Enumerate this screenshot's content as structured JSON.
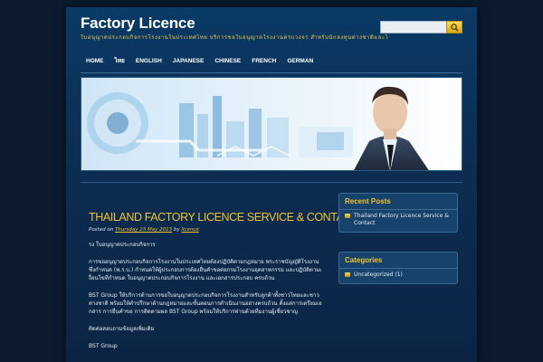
{
  "site": {
    "title": "Factory Licence",
    "tagline": "ใบอนุญาตประกอบกิจการโรงงานในประเทศไทย บริการขอใบอนุญาตโรงงานครบวงจร สำหรับนักลงทุนต่างชาติและไทย"
  },
  "search": {
    "placeholder": ""
  },
  "nav": {
    "items": [
      "HOME",
      "ไทย",
      "ENGLISH",
      "JAPANESE",
      "CHINESE",
      "FRENCH",
      "GERMAN"
    ]
  },
  "post": {
    "title": "THAILAND FACTORY LICENCE SERVICE & CONTACT",
    "meta_prefix": "Posted on",
    "date": "Thursday 23 May 2013",
    "meta_by": "by",
    "author": "licence",
    "paragraphs": [
      "รง ใบอนุญาตประกอบกิจการ",
      "การขออนุญาตประกอบกิจการโรงงานในประเทศไทยต้องปฏิบัติตามกฎหมาย พระราชบัญญัติโรงงานซึ่งกำหนด (พ.ร.บ.) กำหนดให้ผู้ประกอบการต้องยื่นคำขอต่อกรมโรงงานอุตสาหกรรม และปฏิบัติตามเงื่อนไขที่กำหนด ใบอนุญาตประกอบกิจการโรงงาน และเอกสารประกอบ ครบถ้วน",
      "BST Group ให้บริการด้านการขอใบอนุญาตประกอบกิจการโรงงานสำหรับลูกค้าทั้งชาวไทยและชาวต่างชาติ พร้อมให้คำปรึกษาด้านกฎหมายและขั้นตอนการดำเนินงานอย่างครบถ้วน ตั้งแต่การเตรียมเอกสาร การยื่นคำขอ การติดตามผล BST Group พร้อมให้บริการท่านด้วยทีมงานผู้เชี่ยวชาญ",
      "ติดต่อสอบถามข้อมูลเพิ่มเติม",
      "BST Group"
    ]
  },
  "sidebar": {
    "recent_posts": {
      "title": "Recent Posts",
      "items": [
        "Thailand Factory Licence Service & Contact"
      ]
    },
    "categories": {
      "title": "Categories",
      "items": [
        "Uncategorized (1)"
      ]
    }
  },
  "colors": {
    "accent": "#f1c232",
    "background": "#0b1a2e",
    "panel": "#17426b"
  },
  "icons": {
    "search": "search-icon",
    "bullet": "bullet-icon"
  }
}
